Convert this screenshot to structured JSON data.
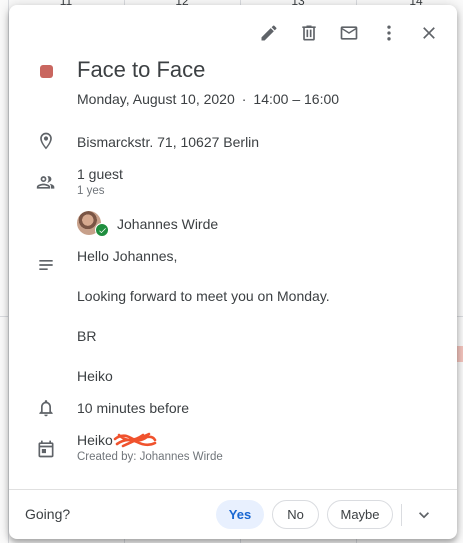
{
  "background": {
    "day_numbers": [
      "11",
      "12",
      "13",
      "14"
    ]
  },
  "toolbar": {
    "edit_icon": "pencil-icon",
    "delete_icon": "trash-icon",
    "email_icon": "envelope-icon",
    "more_icon": "vertical-dots-icon",
    "close_icon": "close-icon"
  },
  "event": {
    "color": "#c9665f",
    "title": "Face to Face",
    "date": "Monday, August 10, 2020",
    "separator": "·",
    "time": "14:00 – 16:00",
    "location": "Bismarckstr. 71, 10627 Berlin",
    "guests": {
      "summary": "1 guest",
      "responses": "1 yes",
      "list": [
        {
          "name": "Johannes Wirde",
          "status": "accepted"
        }
      ]
    },
    "description": [
      "Hello Johannes,",
      "Looking forward to meet you on Monday.",
      "BR",
      "Heiko"
    ],
    "reminder": "10 minutes before",
    "calendar": {
      "name": "Heiko",
      "creator": "Created by: Johannes Wirde"
    }
  },
  "footer": {
    "going_label": "Going?",
    "yes_label": "Yes",
    "no_label": "No",
    "maybe_label": "Maybe",
    "selected": "Yes",
    "accent": "#1967d2"
  }
}
